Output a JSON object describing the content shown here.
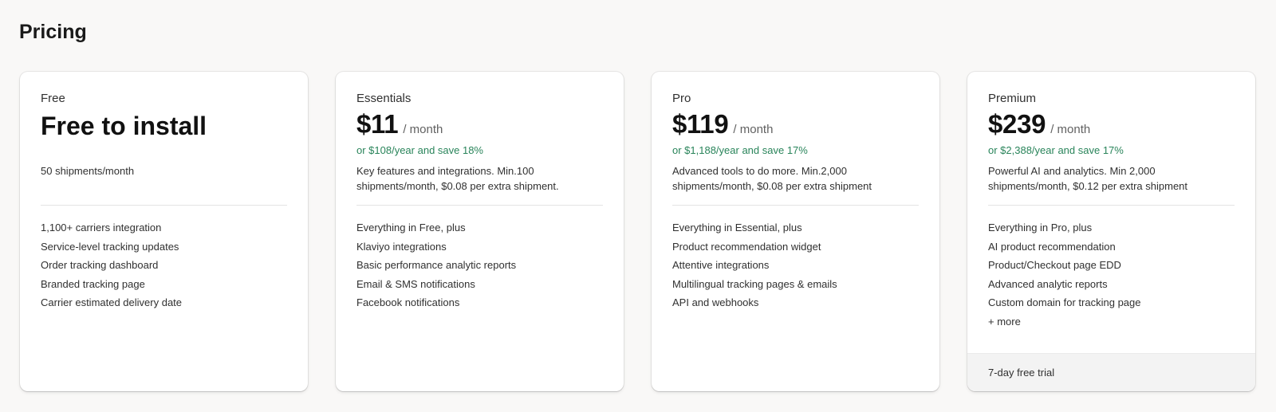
{
  "page": {
    "title": "Pricing"
  },
  "plans": [
    {
      "name": "Free",
      "price_text": "Free to install",
      "description": "50 shipments/month",
      "features": [
        "1,100+ carriers integration",
        "Service-level tracking updates",
        "Order tracking dashboard",
        "Branded tracking page",
        "Carrier estimated delivery date"
      ]
    },
    {
      "name": "Essentials",
      "price": "$11",
      "period": "/ month",
      "yearly": "or $108/year and save 18%",
      "description": "Key features and integrations. Min.100 shipments/month, $0.08 per extra shipment.",
      "features": [
        "Everything in Free, plus",
        "Klaviyo integrations",
        "Basic performance analytic reports",
        "Email & SMS notifications",
        "Facebook notifications"
      ]
    },
    {
      "name": "Pro",
      "price": "$119",
      "period": "/ month",
      "yearly": "or $1,188/year and save 17%",
      "description": "Advanced tools to do more. Min.2,000 shipments/month, $0.08 per extra shipment",
      "features": [
        "Everything in Essential, plus",
        "Product recommendation widget",
        "Attentive integrations",
        "Multilingual tracking pages & emails",
        "API and webhooks"
      ]
    },
    {
      "name": "Premium",
      "price": "$239",
      "period": "/ month",
      "yearly": "or $2,388/year and save 17%",
      "description": "Powerful AI and analytics. Min 2,000 shipments/month, $0.12 per extra shipment",
      "features": [
        "Everything in Pro, plus",
        "AI product recommendation",
        "Product/Checkout page EDD",
        "Advanced analytic reports",
        "Custom domain for tracking page",
        "+ more"
      ],
      "footer": "7-day free trial"
    }
  ],
  "colors": {
    "background": "#f9f8f7",
    "card": "#ffffff",
    "savings_text": "#29845a",
    "footer_bg": "#f3f3f3"
  }
}
